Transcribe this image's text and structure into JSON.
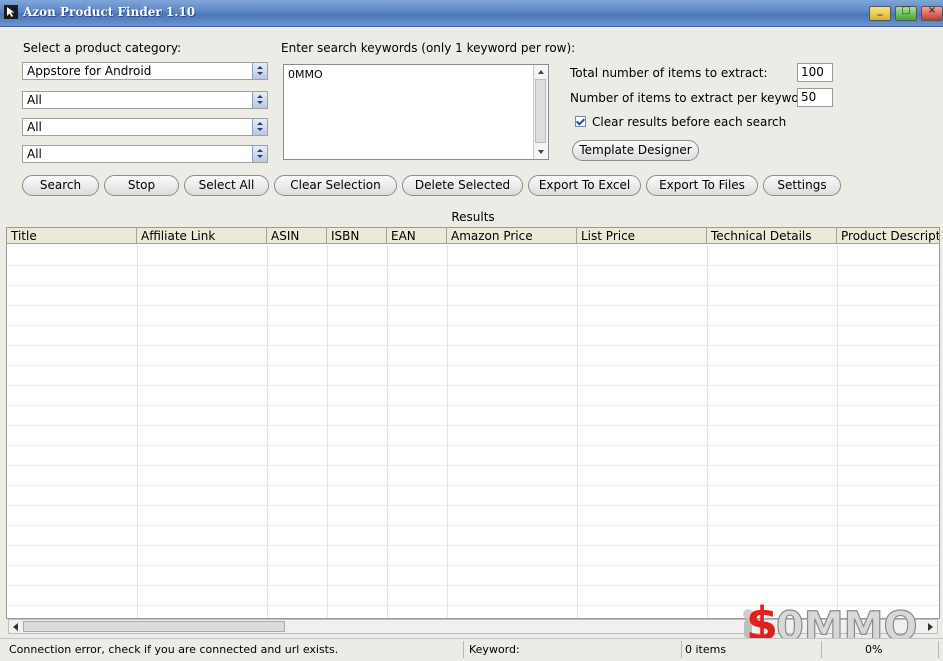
{
  "window": {
    "title": "Azon Product Finder 1.10",
    "icon": "app-cursor-icon"
  },
  "category": {
    "label": "Select a product category:",
    "selects": [
      "Appstore for Android",
      "All",
      "All",
      "All"
    ]
  },
  "keywords": {
    "label": "Enter search keywords (only 1 keyword  per row):",
    "value": "0MMO"
  },
  "extract": {
    "total_label": "Total number of items to extract:",
    "total_value": "100",
    "per_keyword_label": "Number of items to extract  per keyword:",
    "per_keyword_value": "50",
    "clear_label": "Clear results before each search",
    "clear_checked": true
  },
  "buttons": {
    "template_designer": "Template Designer",
    "search": "Search",
    "stop": "Stop",
    "select_all": "Select All",
    "clear_selection": "Clear Selection",
    "delete_selected": "Delete Selected",
    "export_excel": "Export To Excel",
    "export_files": "Export To Files",
    "settings": "Settings"
  },
  "results": {
    "title": "Results",
    "columns": [
      "Title",
      "Affiliate Link",
      "ASIN",
      "ISBN",
      "EAN",
      "Amazon Price",
      "List Price",
      "Technical Details",
      "Product Descripti"
    ],
    "rows": []
  },
  "status": {
    "message": "Connection error, check if you are connected and url exists.",
    "keyword_label": "Keyword:",
    "items": "0 items",
    "progress": "0%"
  },
  "watermark": {
    "text": "$0MMO"
  },
  "colors": {
    "titlebar": "#5a86c6",
    "watermark_red": "#e0201c",
    "watermark_gray": "#9a9a9a"
  }
}
